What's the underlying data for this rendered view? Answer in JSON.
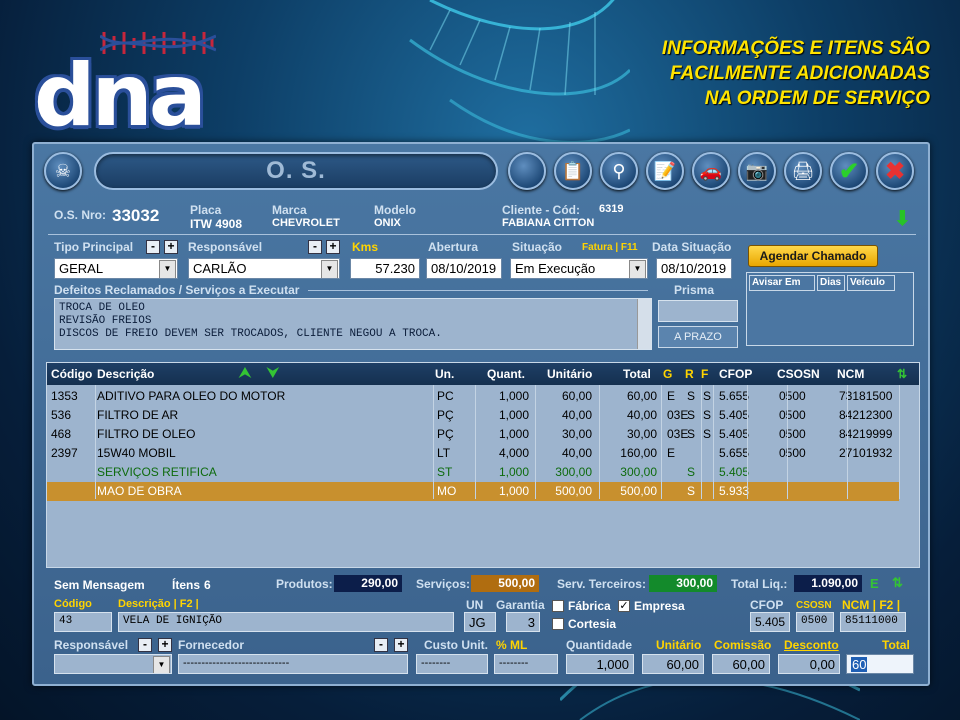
{
  "headline": [
    "INFORMAÇÕES E ITENS SÃO",
    "FACILMENTE  ADICIONADAS",
    "NA ORDEM DE SERVIÇO"
  ],
  "logo": {
    "text": "dna"
  },
  "window": {
    "title": "O. S."
  },
  "toolbar": {
    "icons": [
      "skull-icon",
      "clipboard-icon",
      "search-icon",
      "notes-icon",
      "car-icon",
      "camera-icon",
      "printer-icon",
      "check-icon",
      "close-icon"
    ]
  },
  "header": {
    "os_label": "O.S. Nro:",
    "os_number": "33032",
    "placa_label": "Placa",
    "placa": "ITW 4908",
    "marca_label": "Marca",
    "marca": "CHEVROLET",
    "modelo_label": "Modelo",
    "modelo": "ONIX",
    "cliente_label": "Cliente  -  Cód:",
    "cliente_cod": "6319",
    "cliente": "FABIANA CITTON"
  },
  "form": {
    "tipo_label": "Tipo Principal",
    "tipo": "GERAL",
    "resp_label": "Responsável",
    "resp": "CARLÃO",
    "kms_label": "Kms",
    "kms": "57.230",
    "abertura_label": "Abertura",
    "abertura": "08/10/2019",
    "situacao_label": "Situação",
    "situacao": "Em Execução",
    "fatura_label": "Fatura  |  F11",
    "data_sit_label": "Data Situação",
    "data_sit": "08/10/2019",
    "agendar_label": "Agendar Chamado",
    "defeitos_label": "Defeitos Reclamados / Serviços a Executar",
    "defeitos": [
      "TROCA DE OLEO",
      "REVISÃO FREIOS",
      "DISCOS DE FREIO DEVEM SER TROCADOS, CLIENTE NEGOU A TROCA."
    ],
    "prisma_label": "Prisma",
    "prisma": "",
    "aprazo_label": "A PRAZO",
    "aviso_headers": [
      "Avisar Em",
      "Dias",
      "Veículo"
    ]
  },
  "grid": {
    "headers": {
      "codigo": "Código",
      "descricao": "Descrição",
      "un": "Un.",
      "quant": "Quant.",
      "unitario": "Unitário",
      "total": "Total",
      "g": "G",
      "r": "R",
      "f": "F",
      "cfop": "CFOP",
      "csosn": "CSOSN",
      "ncm": "NCM"
    },
    "rows": [
      {
        "codigo": "1353",
        "descricao": "ADITIVO PARA OLEO DO MOTOR",
        "un": "PC",
        "quant": "1,000",
        "unitario": "60,00",
        "total": "60,00",
        "g": "E",
        "r": "S",
        "f": "S",
        "cfop": "5.655",
        "csosn": "0500",
        "ncm": "73181500",
        "type": "normal"
      },
      {
        "codigo": "536",
        "descricao": "FILTRO DE AR",
        "un": "PÇ",
        "quant": "1,000",
        "unitario": "40,00",
        "total": "40,00",
        "g": "03E",
        "r": "S",
        "f": "S",
        "cfop": "5.405",
        "csosn": "0500",
        "ncm": "84212300",
        "type": "normal"
      },
      {
        "codigo": "468",
        "descricao": "FILTRO DE OLEO",
        "un": "PÇ",
        "quant": "1,000",
        "unitario": "30,00",
        "total": "30,00",
        "g": "03E",
        "r": "S",
        "f": "S",
        "cfop": "5.405",
        "csosn": "0500",
        "ncm": "84219999",
        "type": "normal"
      },
      {
        "codigo": "2397",
        "descricao": "15W40 MOBIL",
        "un": "LT",
        "quant": "4,000",
        "unitario": "40,00",
        "total": "160,00",
        "g": "E",
        "r": "",
        "f": "",
        "cfop": "5.655",
        "csosn": "0500",
        "ncm": "27101932",
        "type": "normal"
      },
      {
        "codigo": "",
        "descricao": "SERVIÇOS RETIFICA",
        "un": "ST",
        "quant": "1,000",
        "unitario": "300,00",
        "total": "300,00",
        "g": "",
        "r": "S",
        "f": "",
        "cfop": "5.405",
        "csosn": "",
        "ncm": "",
        "type": "green"
      },
      {
        "codigo": "",
        "descricao": "MAO DE OBRA",
        "un": "MO",
        "quant": "1,000",
        "unitario": "500,00",
        "total": "500,00",
        "g": "",
        "r": "S",
        "f": "",
        "cfop": "5.933",
        "csosn": "",
        "ncm": "",
        "type": "sel"
      }
    ]
  },
  "totals": {
    "mensagem": "Sem Mensagem",
    "itens_label": "Ítens",
    "itens": "6",
    "produtos_label": "Produtos:",
    "produtos": "290,00",
    "servicos_label": "Serviços:",
    "servicos": "500,00",
    "terceiros_label": "Serv. Terceiros:",
    "terceiros": "300,00",
    "liquido_label": "Total Liq.:",
    "liquido": "1.090,00",
    "e_label": "E"
  },
  "item": {
    "codigo_label": "Código",
    "codigo": "43",
    "descricao_label": "Descrição | F2 |",
    "descricao": "VELA DE IGNIÇÃO",
    "un_label": "UN",
    "un": "JG",
    "garantia_label": "Garantia",
    "garantia": "3",
    "fabrica_label": "Fábrica",
    "empresa_label": "Empresa",
    "cortesia_label": "Cortesia",
    "cfop_label": "CFOP",
    "cfop": "5.405",
    "csosn_label": "CSOSN",
    "csosn": "0500",
    "ncm_label": "NCM | F2 |",
    "ncm": "85111000",
    "responsavel_label": "Responsável",
    "responsavel": "",
    "fornecedor_label": "Fornecedor",
    "fornecedor": "-----------------------------",
    "custo_label": "Custo Unit.",
    "custo": "--------",
    "ml_label": "% ML",
    "ml": "--------",
    "quantidade_label": "Quantidade",
    "quantidade": "1,000",
    "unitario_label": "Unitário",
    "unitario": "60,00",
    "comissao_label": "Comissão",
    "comissao": "60,00",
    "desconto_label": "Desconto",
    "desconto": "0,00",
    "total_label": "Total",
    "total": "60"
  },
  "colors": {
    "accent": "#ffd400",
    "headline": "#ffe400",
    "selected_row": "#c8902e",
    "green_text": "#0e6b0e",
    "produtos_bg": "#0c1e4a",
    "servicos_bg": "#b06d10",
    "terceiros_bg": "#138a2b",
    "liquido_bg": "#0c1e4a"
  }
}
